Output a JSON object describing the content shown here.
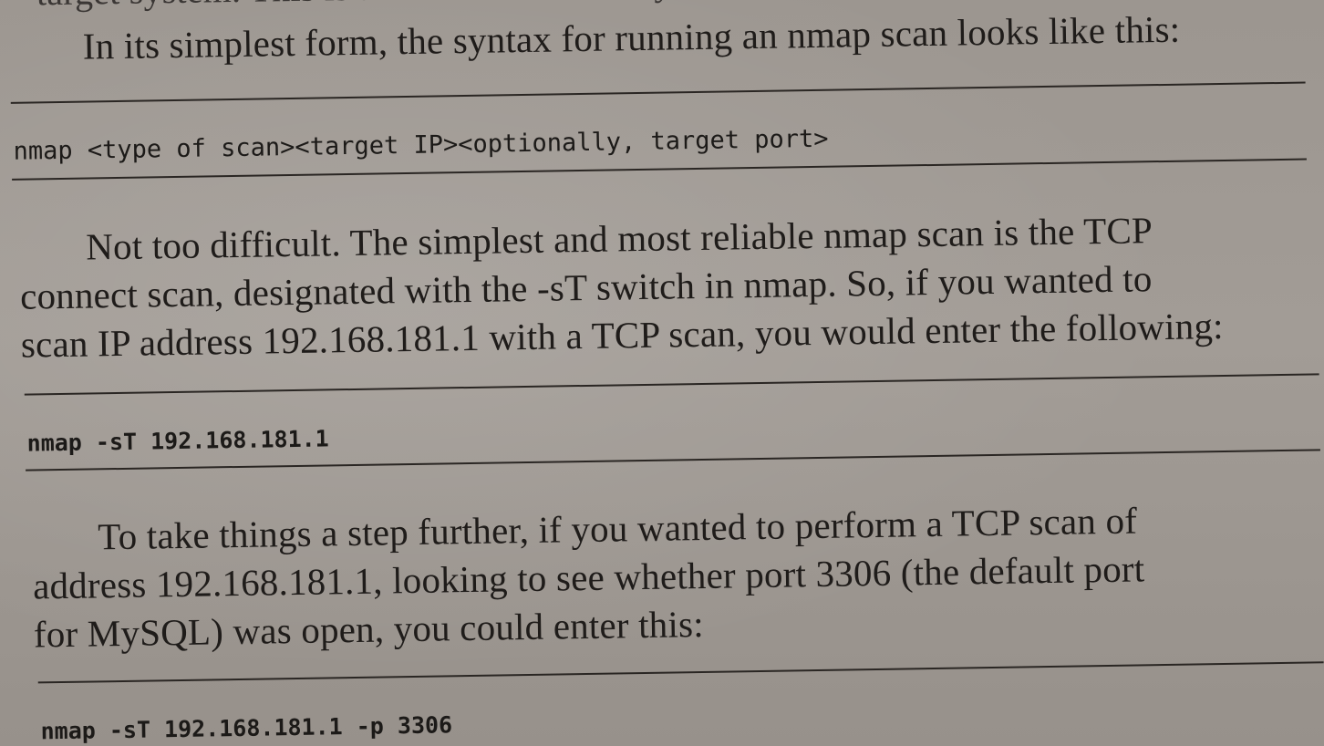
{
  "book_page": {
    "cut_off_top_line": "target system. This is a crucial skill for any",
    "paragraph1": "In its simplest form, the syntax for running an nmap scan looks like this:",
    "code1": "nmap <type of scan><target IP><optionally, target port>",
    "paragraph2_lines": [
      "Not too difficult. The simplest and most reliable nmap scan is the TCP",
      "connect scan, designated with the -sT switch in nmap. So, if you wanted to",
      "scan IP address 192.168.181.1 with a TCP scan, you would enter the following:"
    ],
    "code2": "nmap -sT 192.168.181.1",
    "paragraph3_lines": [
      "To take things a step further, if you wanted to perform a TCP scan of",
      "address 192.168.181.1, looking to see whether port 3306 (the default port",
      "for MySQL) was open, you could enter this:"
    ],
    "code3": "nmap -sT 192.168.181.1 -p 3306"
  }
}
